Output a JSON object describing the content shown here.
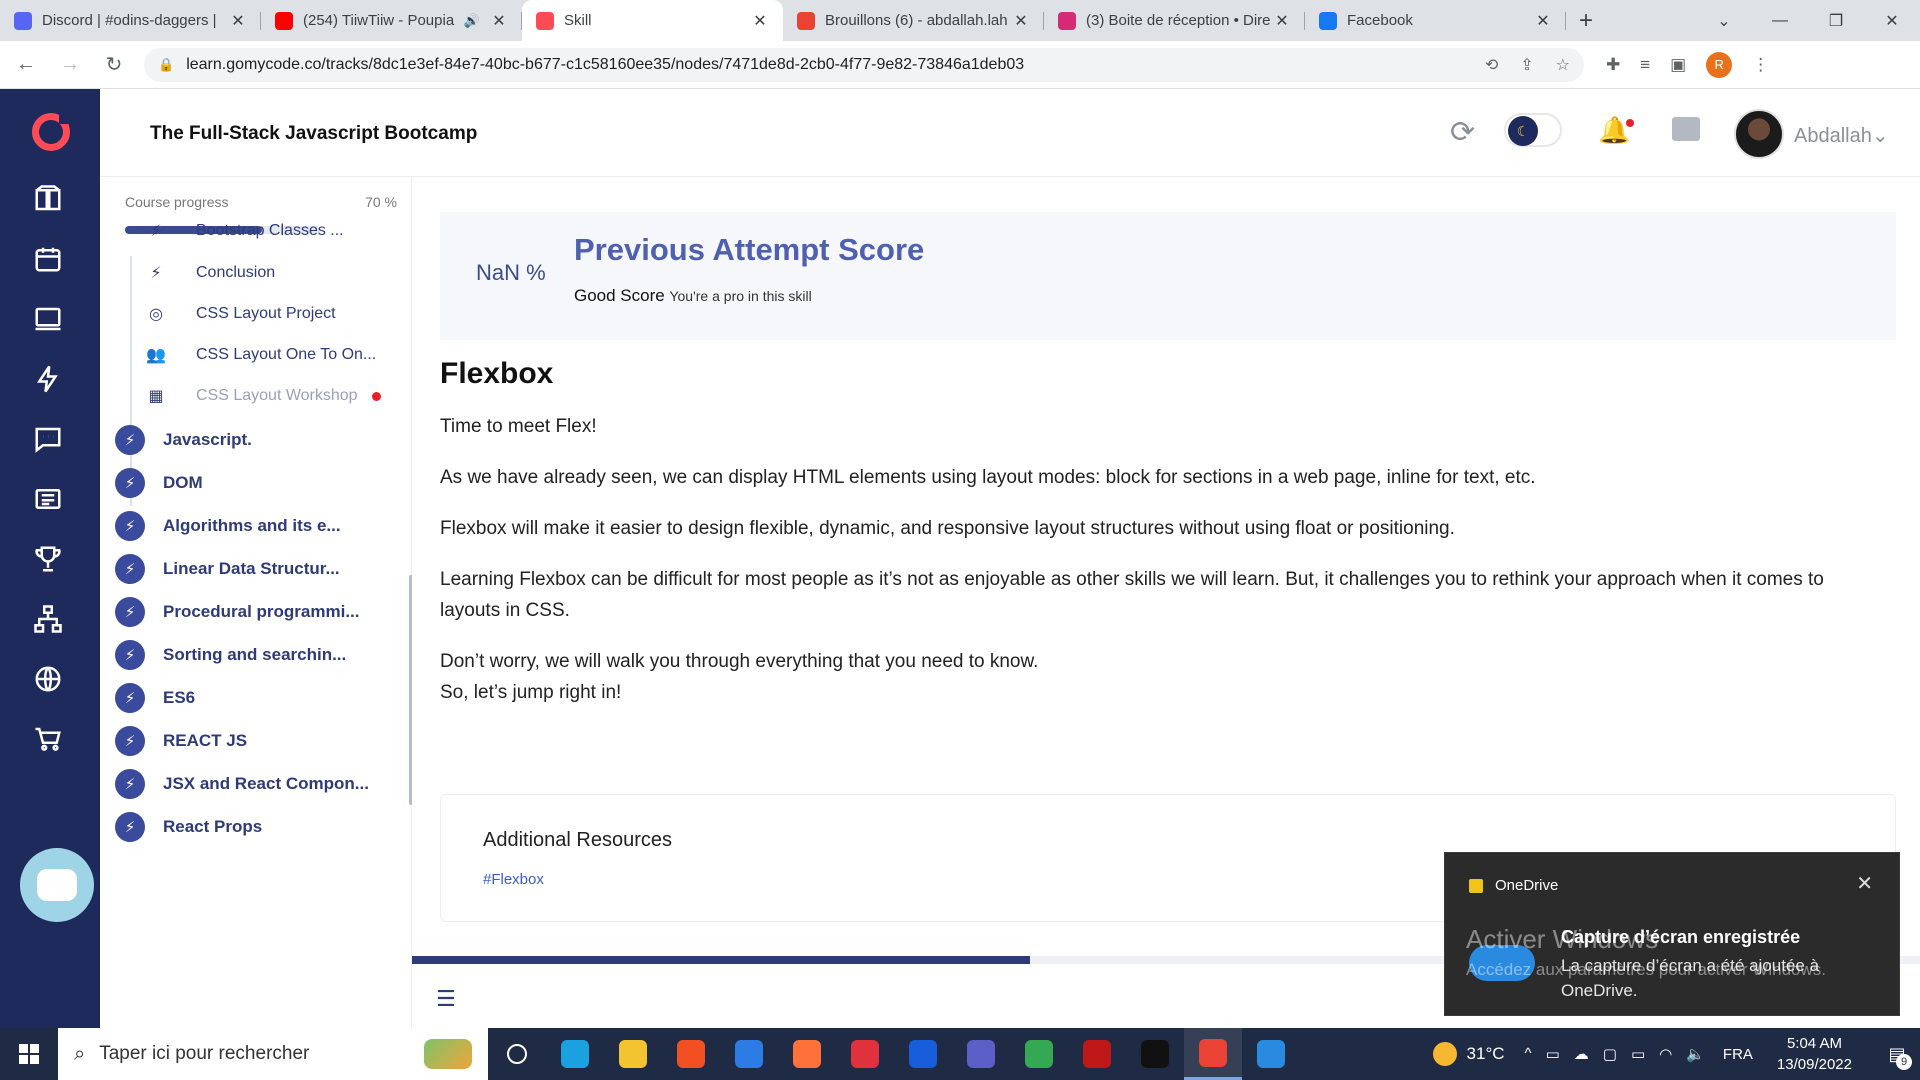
{
  "browser": {
    "tabs": [
      {
        "title": "Discord | #odins-daggers | ",
        "favicon_color": "#5865f2",
        "favicon": "discord-icon",
        "active": false
      },
      {
        "title": "(254) TiiwTiiw - Poupia",
        "favicon_color": "#ff0000",
        "favicon": "youtube-icon",
        "active": false,
        "audio": "🔊"
      },
      {
        "title": "Skill",
        "favicon_color": "#ff4b55",
        "favicon": "gomycode-icon",
        "active": true
      },
      {
        "title": "Brouillons (6) - abdallah.lah",
        "favicon_color": "#ea4335",
        "favicon": "gmail-icon",
        "active": false
      },
      {
        "title": "(3) Boite de réception • Dire",
        "favicon_color": "#d62976",
        "favicon": "instagram-icon",
        "active": false
      },
      {
        "title": "Facebook",
        "favicon_color": "#1877f2",
        "favicon": "facebook-icon",
        "active": false
      }
    ],
    "tab_close": "✕",
    "new_tab": "+",
    "url": "learn.gomycode.co/tracks/8dc1e3ef-84e7-40bc-b677-c1c58160ee35/nodes/7471de8d-2cb0-4f77-9e82-73846a1deb03",
    "profile_letter": "R"
  },
  "header": {
    "course_title": "The Full-Stack Javascript Bootcamp",
    "username": "Abdallah",
    "username_caret": "⌄"
  },
  "outline": {
    "progress_label": "Course progress",
    "progress_pct": "70 %",
    "progress_value": 0.7,
    "sub_items": [
      {
        "label": "Bootstrap Classes ...",
        "icon": "bolt-icon",
        "glyph": "⚡",
        "muted": false
      },
      {
        "label": "Conclusion",
        "icon": "bolt-icon",
        "glyph": "⚡",
        "muted": false
      },
      {
        "label": "CSS Layout Project",
        "icon": "target-icon",
        "glyph": "◎",
        "muted": false
      },
      {
        "label": "CSS Layout One To On...",
        "icon": "people-icon",
        "glyph": "👥",
        "muted": false
      },
      {
        "label": "CSS Layout Workshop",
        "icon": "workshop-icon",
        "glyph": "▦",
        "muted": true
      }
    ],
    "chapters": [
      "Javascript.",
      "DOM",
      "Algorithms and its e...",
      "Linear Data Structur...",
      "Procedural programmi...",
      "Sorting and searchin...",
      "ES6",
      "REACT JS",
      "JSX and React Compon...",
      "React Props"
    ]
  },
  "score": {
    "pct": "NaN %",
    "title": "Previous Attempt Score",
    "label": "Good Score",
    "note": "You're a pro in this skill"
  },
  "lesson": {
    "title": "Flexbox",
    "paragraphs": [
      "Time to meet Flex!",
      "As we have already seen, we can display HTML elements using layout modes: block for sections in a web page, inline for text, etc.",
      "Flexbox will make it easier to design flexible, dynamic, and responsive layout structures without using float or positioning.",
      "Learning Flexbox can be difficult for most people as it’s not as enjoyable as other skills we will learn. But, it challenges you to rethink your approach when it comes to layouts in CSS."
    ],
    "closing_line1": "Don’t worry, we will walk you through everything that you need to know.",
    "closing_line2": "So, let’s jump right in!",
    "lesson_progress": 0.41
  },
  "resources": {
    "title": "Additional Resources",
    "tag": "#Flexbox"
  },
  "toast": {
    "app": "OneDrive",
    "title": "Capture d’écran enregistrée",
    "body": "La capture d’écran a été ajoutée à OneDrive.",
    "close": "✕"
  },
  "watermark": {
    "line1": "Activer Windows",
    "line2": "Accédez aux paramètres pour activer Windows."
  },
  "taskbar": {
    "search_placeholder": "Taper ici pour rechercher",
    "temperature": "31°C",
    "language": "FRA",
    "time": "5:04 AM",
    "date": "13/09/2022",
    "notification_count": "9",
    "apps": [
      "task-view",
      "edge",
      "file-explorer",
      "microsoft-store",
      "mail",
      "firefox",
      "valorant",
      "bitwarden",
      "teams",
      "chrome",
      "mcafee",
      "epic-games",
      "chrome-profile",
      "photos"
    ]
  },
  "colors": {
    "rail": "#1d2a5b",
    "accent": "#5060b0",
    "brand": "#ff4b55"
  }
}
